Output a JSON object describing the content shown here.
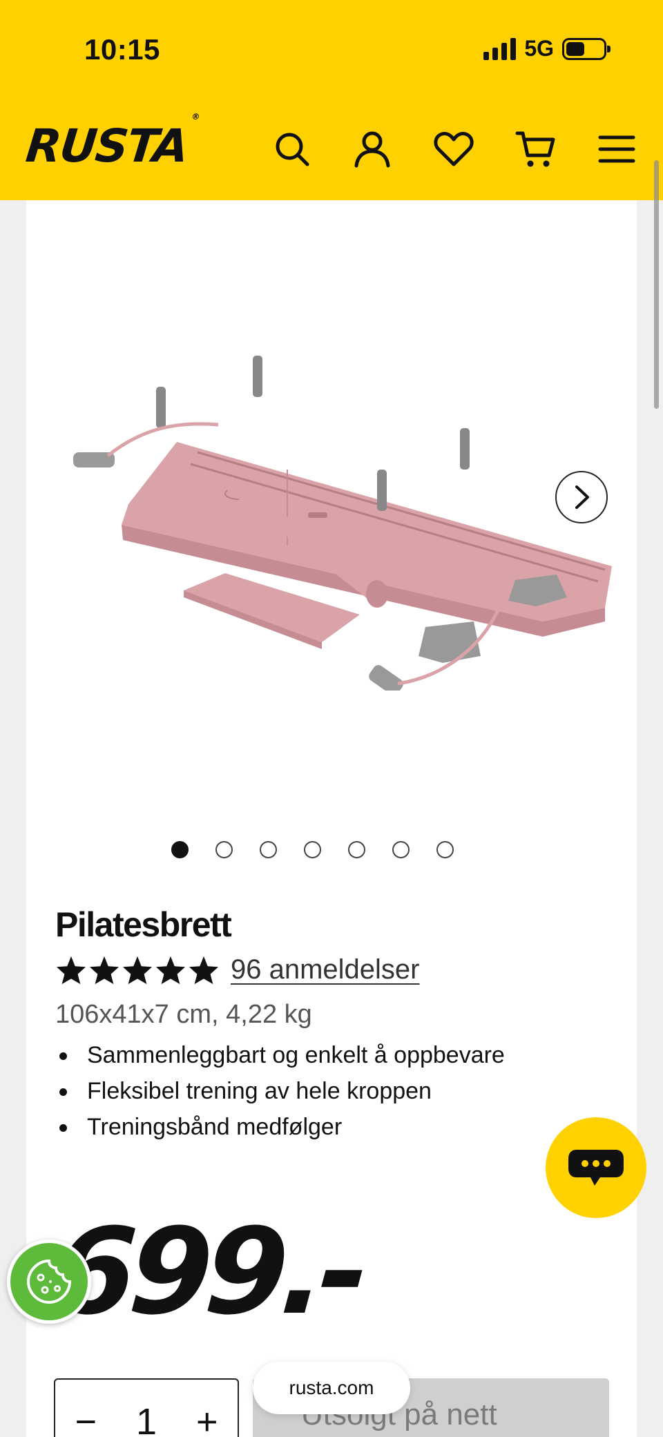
{
  "status_bar": {
    "time": "10:15",
    "network": "5G"
  },
  "header": {
    "logo": "RUSTA",
    "icons": [
      "search-icon",
      "account-icon",
      "heart-icon",
      "cart-icon",
      "menu-icon"
    ]
  },
  "gallery": {
    "total_images": 7,
    "active_index": 0
  },
  "product": {
    "title": "Pilatesbrett",
    "rating": 5,
    "reviews_label": "96 anmeldelser",
    "specs": "106x41x7 cm, 4,22 kg",
    "features": [
      "Sammenleggbart og enkelt å oppbevare",
      "Fleksibel trening av hele kroppen",
      "Treningsbånd medfølger"
    ],
    "price": "699.-"
  },
  "purchase": {
    "minus": "−",
    "quantity": "1",
    "plus": "+",
    "sold_out_label": "Utsolgt på nett"
  },
  "browser": {
    "url": "rusta.com"
  },
  "colors": {
    "brand_yellow": "#ffd100",
    "cookie_green": "#5dba3b",
    "product_pink": "#d9a3a8"
  }
}
